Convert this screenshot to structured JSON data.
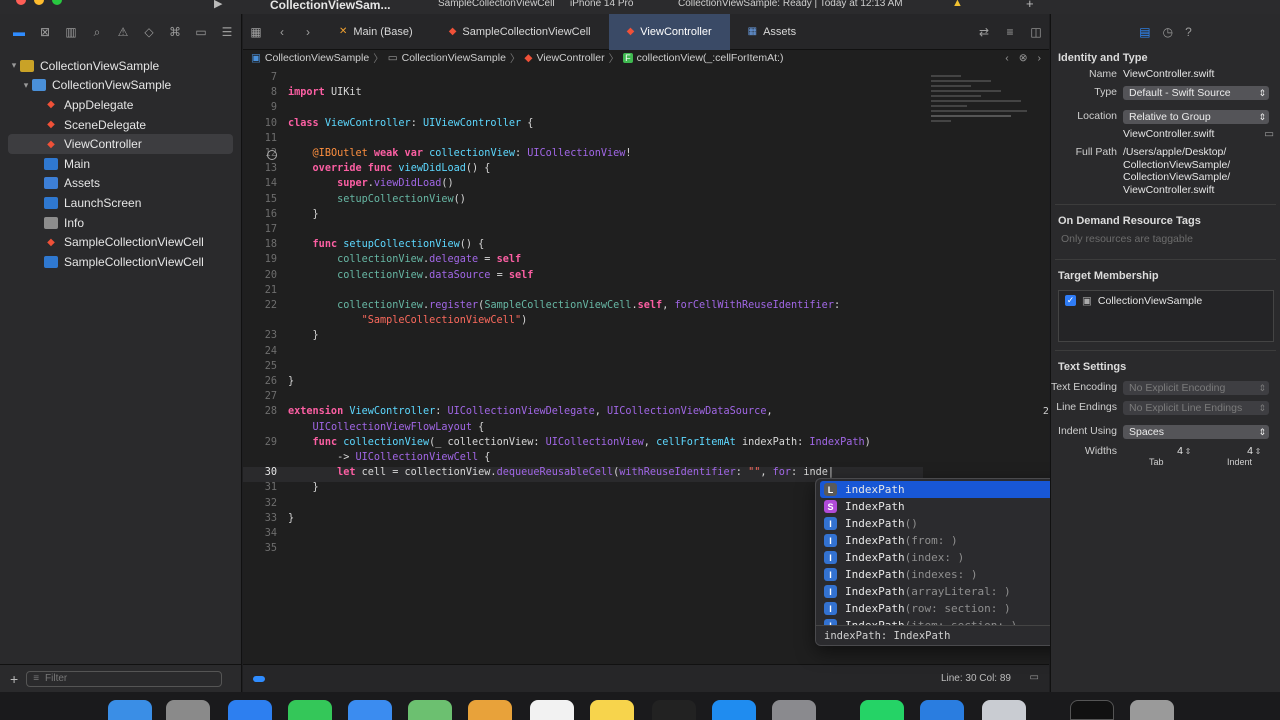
{
  "toolbar": {
    "project_title": "CollectionViewSam...",
    "scheme": "SampleCollectionViewCell",
    "device": "iPhone 14 Pro",
    "status": "CollectionViewSample: Ready | Today at 12:13 AM",
    "warning_icon": "warning-triangle-icon"
  },
  "navigator": {
    "items": [
      {
        "label": "CollectionViewSample",
        "indent": 0,
        "icon": "project"
      },
      {
        "label": "CollectionViewSample",
        "indent": 1,
        "icon": "folder"
      },
      {
        "label": "AppDelegate",
        "indent": 2,
        "icon": "swift"
      },
      {
        "label": "SceneDelegate",
        "indent": 2,
        "icon": "swift"
      },
      {
        "label": "ViewController",
        "indent": 2,
        "icon": "swift",
        "selected": true
      },
      {
        "label": "Main",
        "indent": 2,
        "icon": "storyboard"
      },
      {
        "label": "Assets",
        "indent": 2,
        "icon": "assets"
      },
      {
        "label": "LaunchScreen",
        "indent": 2,
        "icon": "storyboard"
      },
      {
        "label": "Info",
        "indent": 2,
        "icon": "info"
      },
      {
        "label": "SampleCollectionViewCell",
        "indent": 2,
        "icon": "swift"
      },
      {
        "label": "SampleCollectionViewCell",
        "indent": 2,
        "icon": "storyboard"
      }
    ],
    "filter_placeholder": "Filter"
  },
  "tabs": [
    {
      "label": "Main (Base)",
      "active": false
    },
    {
      "label": "SampleCollectionViewCell",
      "active": false
    },
    {
      "label": "ViewController",
      "active": true
    },
    {
      "label": "Assets",
      "active": false
    }
  ],
  "breadcrumb": [
    "CollectionViewSample",
    "CollectionViewSample",
    "ViewController",
    "collectionView(_:cellForItemAt:)"
  ],
  "code": [
    {
      "n": "7",
      "html": ""
    },
    {
      "n": "8",
      "html": "<span class=\"kw\">import</span> UIKit"
    },
    {
      "n": "9",
      "html": ""
    },
    {
      "n": "10",
      "html": "<span class=\"kw\">class</span> <span class=\"typ\">ViewController</span>: <span class=\"typ\">UIViewController</span> {"
    },
    {
      "n": "11",
      "html": ""
    },
    {
      "n": "12",
      "html": "    <span class=\"attr\">@IBOutlet</span> <span class=\"kw\">weak var</span> <span class=\"typ\">collectionView</span>: <span class=\"prop\">UICollectionView</span>!",
      "bp": true
    },
    {
      "n": "13",
      "html": "    <span class=\"kw\">override func</span> <span class=\"typ\">viewDidLoad</span>() {"
    },
    {
      "n": "14",
      "html": "        <span class=\"kw\">super</span>.<span class=\"prop\">viewDidLoad</span>()"
    },
    {
      "n": "15",
      "html": "        <span class=\"fn\">setupCollectionView</span>()"
    },
    {
      "n": "16",
      "html": "    }"
    },
    {
      "n": "17",
      "html": ""
    },
    {
      "n": "18",
      "html": "    <span class=\"kw\">func</span> <span class=\"typ\">setupCollectionView</span>() {"
    },
    {
      "n": "19",
      "html": "        <span class=\"fn\">collectionView</span>.<span class=\"prop\">delegate</span> = <span class=\"kw\">self</span>"
    },
    {
      "n": "20",
      "html": "        <span class=\"fn\">collectionView</span>.<span class=\"prop\">dataSource</span> = <span class=\"kw\">self</span>"
    },
    {
      "n": "21",
      "html": ""
    },
    {
      "n": "22",
      "html": "        <span class=\"fn\">collectionView</span>.<span class=\"prop\">register</span>(<span class=\"fn\">SampleCollectionViewCell</span>.<span class=\"kw\">self</span>, <span class=\"prop\">forCellWithReuseIdentifier</span>:"
    },
    {
      "n": "",
      "html": "            <span class=\"str\">\"SampleCollectionViewCell\"</span>)"
    },
    {
      "n": "23",
      "html": "    }"
    },
    {
      "n": "24",
      "html": ""
    },
    {
      "n": "25",
      "html": ""
    },
    {
      "n": "26",
      "html": "}"
    },
    {
      "n": "27",
      "html": ""
    },
    {
      "n": "28",
      "html": "<span class=\"kw\">extension</span> <span class=\"typ\">ViewController</span>: <span class=\"prop\">UICollectionViewDelegate</span>, <span class=\"prop\">UICollectionViewDataSource</span>,"
    },
    {
      "n": "",
      "html": "    <span class=\"prop\">UICollectionViewFlowLayout</span> {"
    },
    {
      "n": "29",
      "html": "    <span class=\"kw\">func</span> <span class=\"typ\">collectionView</span>(_ collectionView: <span class=\"prop\">UICollectionView</span>, <span class=\"typ\">cellForItemAt</span> indexPath: <span class=\"prop\">IndexPath</span>)"
    },
    {
      "n": "",
      "html": "        -> <span class=\"prop\">UICollectionViewCell</span> {"
    },
    {
      "n": "30",
      "html": "        <span class=\"kw\">let</span> cell = collectionView.<span class=\"prop\">dequeueReusableCell</span>(<span class=\"prop\">withReuseIdentifier</span>: <span class=\"str\">\"\"</span>, <span class=\"prop\">for</span>: inde|",
      "cur": true
    },
    {
      "n": "31",
      "html": "    }"
    },
    {
      "n": "32",
      "html": ""
    },
    {
      "n": "33",
      "html": "}"
    },
    {
      "n": "34",
      "html": ""
    },
    {
      "n": "35",
      "html": ""
    }
  ],
  "error_badge": "2",
  "completion": {
    "items": [
      {
        "kind": "L",
        "name": "indexPath",
        "param": ""
      },
      {
        "kind": "S",
        "name": "IndexPath",
        "param": ""
      },
      {
        "kind": "I",
        "name": "IndexPath",
        "param": "()"
      },
      {
        "kind": "I",
        "name": "IndexPath",
        "param": "(from: )"
      },
      {
        "kind": "I",
        "name": "IndexPath",
        "param": "(index: )"
      },
      {
        "kind": "I",
        "name": "IndexPath",
        "param": "(indexes: )"
      },
      {
        "kind": "I",
        "name": "IndexPath",
        "param": "(arrayLiteral: )"
      },
      {
        "kind": "I",
        "name": "IndexPath",
        "param": "(row: section: )"
      },
      {
        "kind": "I",
        "name": "IndexPath",
        "param": "(item: section: )"
      }
    ],
    "more_label": "+1 more",
    "footer": "indexPath: IndexPath"
  },
  "status_bar": {
    "position": "Line: 30  Col: 89"
  },
  "inspector": {
    "identity_title": "Identity and Type",
    "name_label": "Name",
    "name_value": "ViewController.swift",
    "type_label": "Type",
    "type_value": "Default - Swift Source",
    "location_label": "Location",
    "location_value": "Relative to Group",
    "location_file": "ViewController.swift",
    "full_path_label": "Full Path",
    "full_path_value": "/Users/apple/Desktop/ CollectionViewSample/ CollectionViewSample/ ViewController.swift",
    "odr_title": "On Demand Resource Tags",
    "odr_placeholder": "Only resources are taggable",
    "target_title": "Target Membership",
    "target_item": "CollectionViewSample",
    "text_title": "Text Settings",
    "encoding_label": "Text Encoding",
    "encoding_value": "No Explicit Encoding",
    "line_endings_label": "Line Endings",
    "line_endings_value": "No Explicit Line Endings",
    "indent_label": "Indent Using",
    "indent_value": "Spaces",
    "widths_label": "Widths",
    "tab_value": "4",
    "indent_num": "4",
    "tab_label": "Tab",
    "indent_label2": "Indent"
  },
  "colors": {
    "accent": "#2f8cff",
    "selection": "#1857d6",
    "keyword": "#fc5fa3",
    "type": "#5dd8ff",
    "string": "#fc6a5d"
  }
}
